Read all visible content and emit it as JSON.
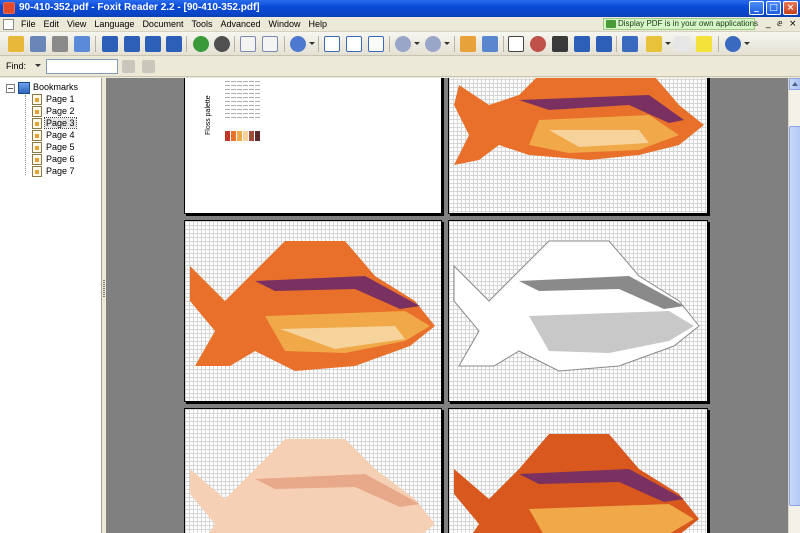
{
  "window": {
    "title": "90-410-352.pdf - Foxit Reader 2.2 - [90-410-352.pdf]",
    "controls": [
      "_",
      "□",
      "×"
    ]
  },
  "menubar": {
    "items": [
      "File",
      "Edit",
      "View",
      "Language",
      "Document",
      "Tools",
      "Advanced",
      "Window",
      "Help"
    ],
    "promo": "Display PDF is in your own applications",
    "mdi_controls": [
      "_",
      "ⅇ",
      "×"
    ]
  },
  "toolbar": {
    "icons": [
      "open-icon",
      "save-icon",
      "print-icon",
      "email-icon",
      "first-page-icon",
      "previous-page-icon",
      "next-page-icon",
      "last-page-icon",
      "go-back-icon",
      "go-forward-icon",
      "zoom-icon",
      "actual-size-icon",
      "fit-page-icon",
      "fit-width-icon",
      "zoom-out-icon",
      "zoom-in-icon",
      "single-page-icon",
      "continuous-icon",
      "hand-tool-icon",
      "loupe-icon",
      "find-icon",
      "select-text-icon",
      "snapshot-icon",
      "pencil-icon",
      "highlighter-icon",
      "typewriter-icon",
      "note-icon",
      "info-icon"
    ]
  },
  "findbar": {
    "label": "Find:",
    "value": ""
  },
  "bookmarks": {
    "root_label": "Bookmarks",
    "expander": "−",
    "items": [
      "Page 1",
      "Page 2",
      "Page 3",
      "Page 4",
      "Page 5",
      "Page 6",
      "Page 7"
    ],
    "selected_index": 2
  },
  "document": {
    "palette_title": "Floss palette",
    "colors": {
      "background": "#808080",
      "fish_orange": "#e8702a",
      "fish_gold": "#f0a848",
      "fish_dark": "#7a3060",
      "fish_light": "#f6d39a",
      "fish_gray": "#8a8a8a"
    }
  }
}
